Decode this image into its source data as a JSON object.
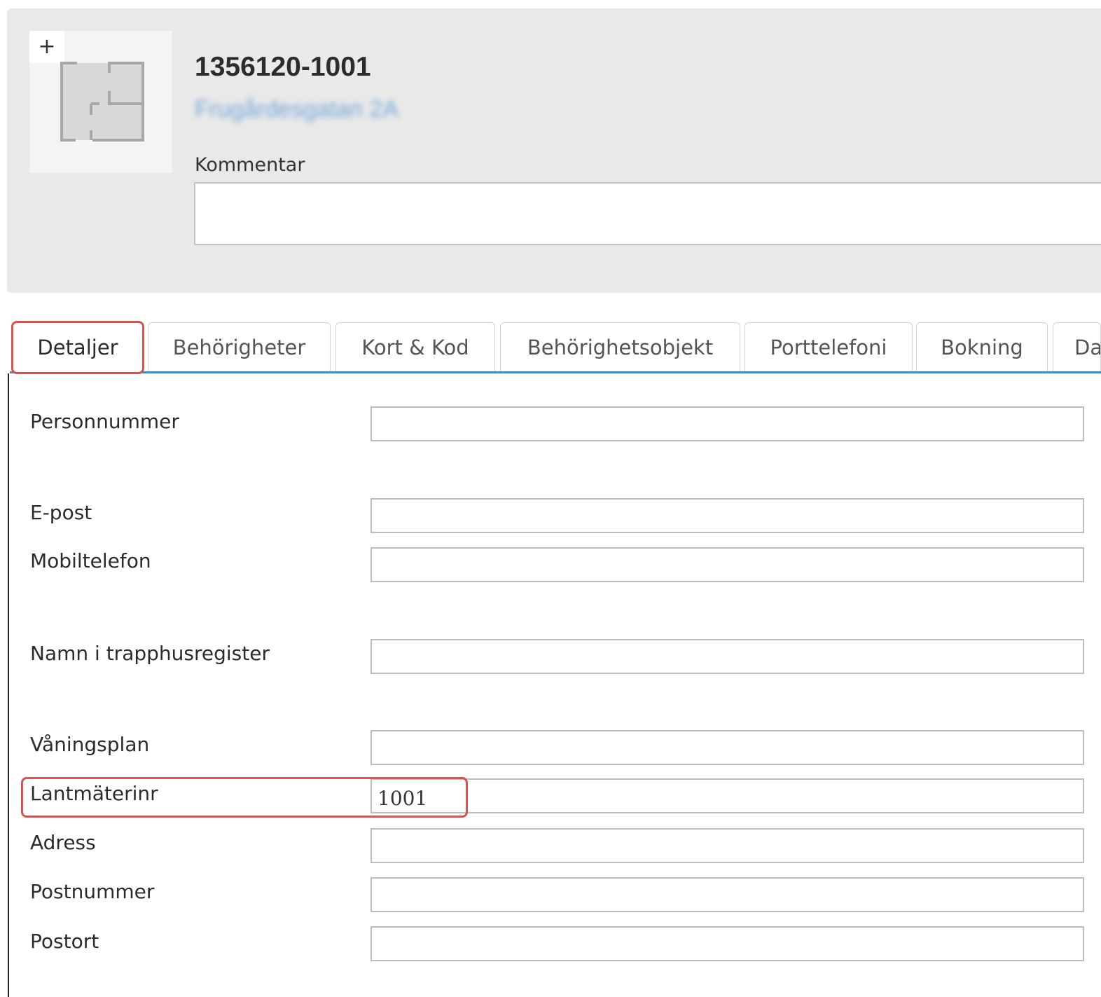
{
  "header": {
    "add_photo_label": "+",
    "object_id": "1356120-1001",
    "object_address": "Frugårdesgatan 2A",
    "comment_label": "Kommentar",
    "comment_value": ""
  },
  "tabs": [
    {
      "label": "Detaljer",
      "active": true
    },
    {
      "label": "Behörigheter",
      "active": false
    },
    {
      "label": "Kort & Kod",
      "active": false
    },
    {
      "label": "Behörighetsobjekt",
      "active": false
    },
    {
      "label": "Porttelefoni",
      "active": false
    },
    {
      "label": "Bokning",
      "active": false
    },
    {
      "label": "Da",
      "active": false
    }
  ],
  "fields": {
    "personnummer": {
      "label": "Personnummer",
      "value": ""
    },
    "epost": {
      "label": "E-post",
      "value": ""
    },
    "mobiltelefon": {
      "label": "Mobiltelefon",
      "value": ""
    },
    "namn_trapphus": {
      "label": "Namn i trapphusregister",
      "value": ""
    },
    "vaningsplan": {
      "label": "Våningsplan",
      "value": ""
    },
    "lantmaterinr": {
      "label": "Lantmäterinr",
      "value": "1001"
    },
    "adress": {
      "label": "Adress",
      "value": ""
    },
    "postnummer": {
      "label": "Postnummer",
      "value": ""
    },
    "postort": {
      "label": "Postort",
      "value": ""
    }
  },
  "colors": {
    "accent": "#2f8fcf",
    "highlight": "#d9534f",
    "header_bg": "#e9e9e9"
  }
}
